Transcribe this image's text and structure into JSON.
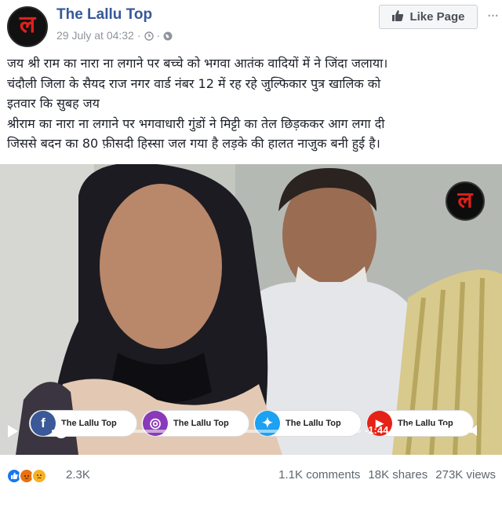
{
  "header": {
    "page_name": "The Lallu Top",
    "avatar_glyph": "ल",
    "timestamp": "29 July at 04:32",
    "separator": "·",
    "like_button_label": "Like Page",
    "more_label": "···"
  },
  "post": {
    "lines": [
      "जय श्री राम का नारा ना लगाने पर बच्चे को भगवा आतंक वादियों में ने जिंदा जलाया।",
      "चंदौली जिला के सैयद राज नगर वार्ड नंबर 12 में रह रहे जुल्फिकार पुत्र खालिक को",
      "इतवार कि सुबह जय",
      "श्रीराम का नारा ना लगाने पर भगवाधारी गुंडों ने मिट्टी का तेल छिड़ककर आग लगा दी",
      "जिससे बदन का 80 फ़ीसदी हिस्सा जल गया है लड़के की हालत नाजुक बनी हुई है।"
    ]
  },
  "video": {
    "watermark_glyph": "ल",
    "social_pills": [
      {
        "icon": "f",
        "label": "The Lallu Top",
        "color": "#3b5998"
      },
      {
        "icon": "◎",
        "label": "The Lallu Top",
        "color": "#8a3ab9"
      },
      {
        "icon": "✦",
        "label": "The Lallu Top",
        "color": "#1da1f2"
      },
      {
        "icon": "▶",
        "label": "The Lallu Top",
        "color": "#e62117"
      }
    ],
    "time_remaining": "-1:44",
    "progress_fraction": 0.03
  },
  "footer": {
    "reaction_count": "2.3K",
    "comments": "1.1K comments",
    "shares": "18K shares",
    "views": "273K views"
  },
  "colors": {
    "link_blue": "#365899",
    "like_blue": "#1877f2",
    "angry": "#e9710f",
    "sad": "#f7b125"
  }
}
